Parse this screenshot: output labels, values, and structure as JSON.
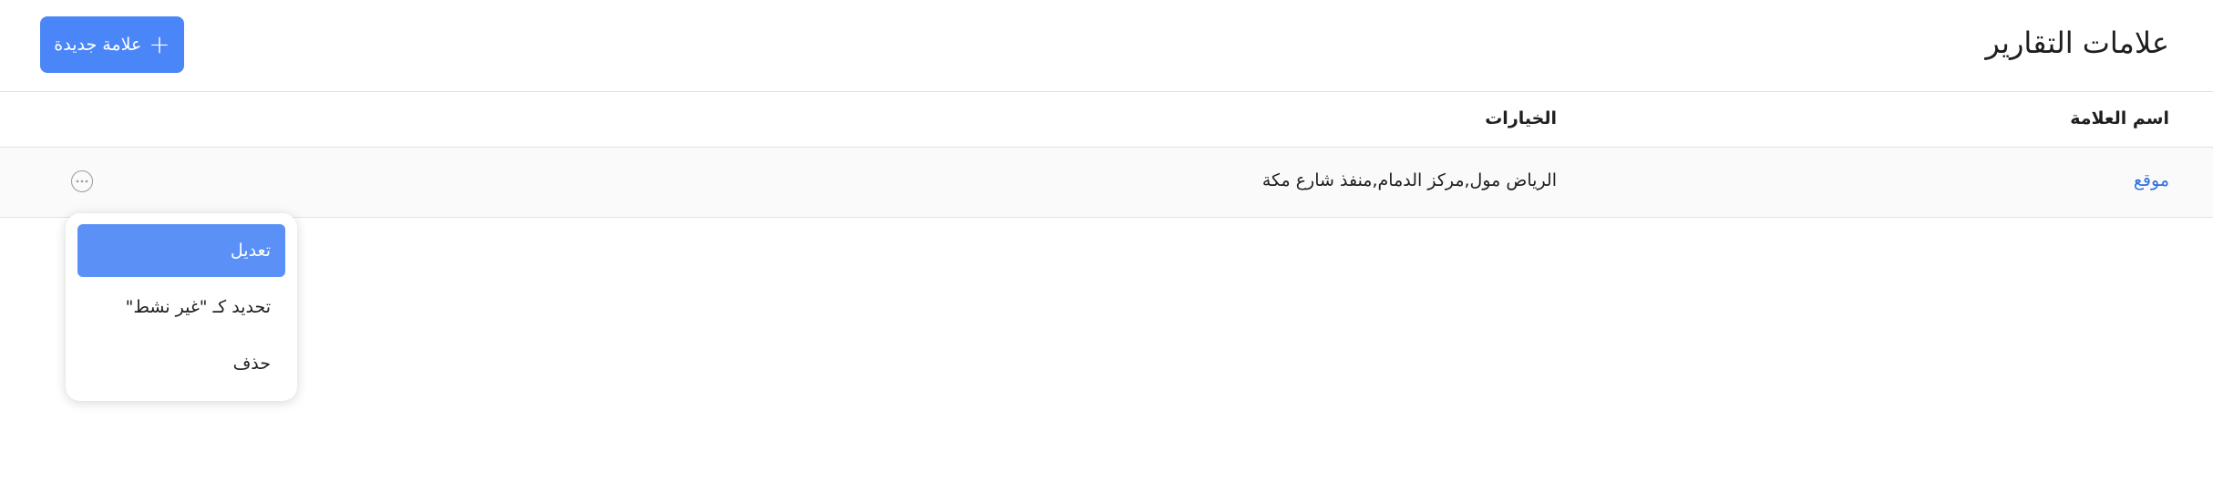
{
  "header": {
    "title": "علامات التقارير",
    "new_button_label": "علامة جديدة",
    "new_button_icon": "plus-icon"
  },
  "table": {
    "columns": {
      "name": "اسم العلامة",
      "options": "الخيارات"
    },
    "rows": [
      {
        "name": "موقع",
        "options": "الرياض مول,مركز الدمام,منفذ شارع مكة",
        "actions_icon": "more-horizontal-icon"
      }
    ]
  },
  "dropdown": {
    "items": [
      {
        "label": "تعديل",
        "active": true
      },
      {
        "label": "تحديد كـ \"غير نشط\"",
        "active": false
      },
      {
        "label": "حذف",
        "active": false
      }
    ]
  },
  "colors": {
    "accent": "#4a86f7",
    "menu_highlight": "#5b91f7",
    "link": "#2f6fe0",
    "border": "#e3e3e3",
    "row_bg": "#fafafa"
  }
}
